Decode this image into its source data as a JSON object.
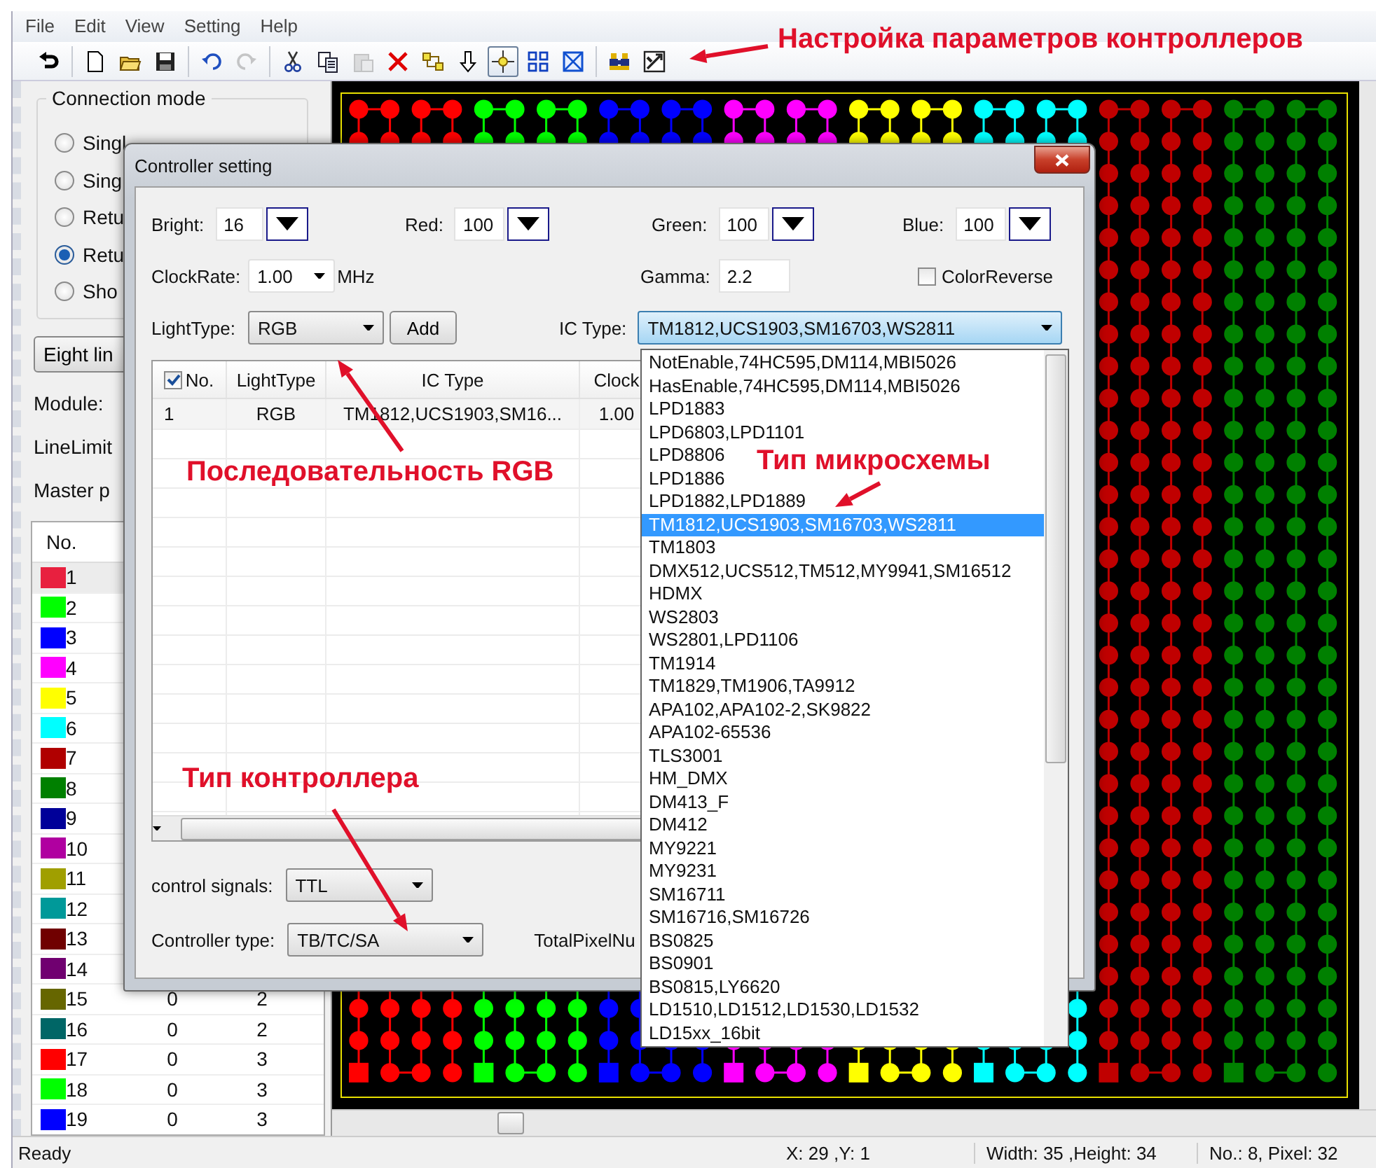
{
  "menu": [
    "File",
    "Edit",
    "View",
    "Setting",
    "Help"
  ],
  "toolbar": [
    [
      {
        "kind": "exit",
        "selected": false,
        "disabled": false
      }
    ],
    [
      {
        "kind": "new",
        "selected": false,
        "disabled": false
      },
      {
        "kind": "open",
        "selected": false,
        "disabled": false
      },
      {
        "kind": "save",
        "selected": false,
        "disabled": false
      }
    ],
    [
      {
        "kind": "undo",
        "selected": false,
        "disabled": false
      },
      {
        "kind": "redo",
        "selected": false,
        "disabled": true
      }
    ],
    [
      {
        "kind": "cut",
        "selected": false,
        "disabled": false
      },
      {
        "kind": "copy",
        "selected": false,
        "disabled": false
      },
      {
        "kind": "paste",
        "selected": false,
        "disabled": true
      },
      {
        "kind": "delete",
        "selected": false,
        "disabled": false
      },
      {
        "kind": "link",
        "selected": false,
        "disabled": false
      },
      {
        "kind": "down",
        "selected": false,
        "disabled": false
      },
      {
        "kind": "crosshair",
        "selected": true,
        "disabled": false
      },
      {
        "kind": "grid",
        "selected": false,
        "disabled": false
      },
      {
        "kind": "frame",
        "selected": false,
        "disabled": false
      }
    ],
    [
      {
        "kind": "find",
        "selected": false,
        "disabled": false
      },
      {
        "kind": "setup",
        "selected": false,
        "disabled": false
      }
    ]
  ],
  "connection_mode": {
    "title": "Connection mode",
    "options": [
      {
        "label": "Singl",
        "selected": false
      },
      {
        "label": "Sing",
        "selected": false
      },
      {
        "label": "Retu",
        "selected": false
      },
      {
        "label": "Retu",
        "selected": true
      },
      {
        "label": "Sho",
        "selected": false
      }
    ]
  },
  "mode_button": "Eight lin",
  "left_labels": [
    "Module:",
    "LineLimit",
    "Master p"
  ],
  "port_table": {
    "header": "No.",
    "rows": [
      {
        "no": "1",
        "color": "#e8203f",
        "selected": true
      },
      {
        "no": "2",
        "color": "#00ff00",
        "selected": false
      },
      {
        "no": "3",
        "color": "#0000ff",
        "selected": false
      },
      {
        "no": "4",
        "color": "#ff00ff",
        "selected": false
      },
      {
        "no": "5",
        "color": "#ffff00",
        "selected": false
      },
      {
        "no": "6",
        "color": "#00ffff",
        "selected": false
      },
      {
        "no": "7",
        "color": "#b00000",
        "selected": false
      },
      {
        "no": "8",
        "color": "#008000",
        "selected": false
      },
      {
        "no": "9",
        "color": "#000099",
        "selected": false
      },
      {
        "no": "10",
        "color": "#b000a0",
        "selected": false
      },
      {
        "no": "11",
        "color": "#a09f00",
        "selected": false
      },
      {
        "no": "12",
        "color": "#009999",
        "selected": false
      },
      {
        "no": "13",
        "color": "#700000",
        "selected": false
      },
      {
        "no": "14",
        "color": "#700070",
        "selected": false
      },
      {
        "no": "15",
        "color": "#666600",
        "selected": false,
        "column_2": "0",
        "column_3": "2"
      },
      {
        "no": "16",
        "color": "#006666",
        "selected": false,
        "column_2": "0",
        "column_3": "2"
      },
      {
        "no": "17",
        "color": "#ff0000",
        "selected": false,
        "column_2": "0",
        "column_3": "3"
      },
      {
        "no": "18",
        "color": "#00ff00",
        "selected": false,
        "column_2": "0",
        "column_3": "3"
      },
      {
        "no": "19",
        "color": "#0000ff",
        "selected": false,
        "column_2": "0",
        "column_3": "3"
      }
    ]
  },
  "dialog": {
    "title": "Controller setting",
    "spinners": [
      {
        "label": "Bright:",
        "value": "16"
      },
      {
        "label": "Red:",
        "value": "100"
      },
      {
        "label": "Green:",
        "value": "100"
      },
      {
        "label": "Blue:",
        "value": "100"
      }
    ],
    "clock_rate": {
      "label": "ClockRate:",
      "value": "1.00",
      "unit": "MHz"
    },
    "gamma": {
      "label": "Gamma:",
      "value": "2.2"
    },
    "color_reverse": {
      "label": "ColorReverse",
      "checked": false
    },
    "light_type": {
      "label": "LightType:",
      "value": "RGB"
    },
    "add_button": "Add",
    "ic_type": {
      "label": "IC Type:",
      "value": "TM1812,UCS1903,SM16703,WS2811",
      "expanded": true,
      "options": [
        {
          "label": "NotEnable,74HC595,DM114,MBI5026",
          "selected": false
        },
        {
          "label": "HasEnable,74HC595,DM114,MBI5026",
          "selected": false
        },
        {
          "label": "LPD1883",
          "selected": false
        },
        {
          "label": "LPD6803,LPD1101",
          "selected": false
        },
        {
          "label": "LPD8806",
          "selected": false
        },
        {
          "label": "LPD1886",
          "selected": false
        },
        {
          "label": "LPD1882,LPD1889",
          "selected": false
        },
        {
          "label": "TM1812,UCS1903,SM16703,WS2811",
          "selected": true
        },
        {
          "label": "TM1803",
          "selected": false
        },
        {
          "label": "DMX512,UCS512,TM512,MY9941,SM16512",
          "selected": false
        },
        {
          "label": "HDMX",
          "selected": false
        },
        {
          "label": "WS2803",
          "selected": false
        },
        {
          "label": "WS2801,LPD1106",
          "selected": false
        },
        {
          "label": "TM1914",
          "selected": false
        },
        {
          "label": "TM1829,TM1906,TA9912",
          "selected": false
        },
        {
          "label": "APA102,APA102-2,SK9822",
          "selected": false
        },
        {
          "label": "APA102-65536",
          "selected": false
        },
        {
          "label": "TLS3001",
          "selected": false
        },
        {
          "label": "HM_DMX",
          "selected": false
        },
        {
          "label": "DM413_F",
          "selected": false
        },
        {
          "label": "DM412",
          "selected": false
        },
        {
          "label": "MY9221",
          "selected": false
        },
        {
          "label": "MY9231",
          "selected": false
        },
        {
          "label": "SM16711",
          "selected": false
        },
        {
          "label": "SM16716,SM16726",
          "selected": false
        },
        {
          "label": "BS0825",
          "selected": false
        },
        {
          "label": "BS0901",
          "selected": false
        },
        {
          "label": "BS0815,LY6620",
          "selected": false
        },
        {
          "label": "LD1510,LD1512,LD1530,LD1532",
          "selected": false
        },
        {
          "label": "LD15xx_16bit",
          "selected": false
        }
      ]
    },
    "table": {
      "select_all_checked": true,
      "columns": [
        "No.",
        "LightType",
        "IC Type",
        "Clock"
      ],
      "rows": [
        {
          "cells": [
            "1",
            "RGB",
            "TM1812,UCS1903,SM16...",
            "1.00"
          ]
        }
      ]
    },
    "control_signals": {
      "label": "control signals:",
      "value": "TTL"
    },
    "controller_type": {
      "label": "Controller type:",
      "value": "TB/TC/SA"
    },
    "total_pixel_label": "TotalPixelNu"
  },
  "annotations": [
    {
      "text": "Настройка параметров контроллеров"
    },
    {
      "text": "Последовательность RGB"
    },
    {
      "text": "Тип микросхемы"
    },
    {
      "text": "Тип контроллера"
    }
  ],
  "status_bar": [
    "Ready",
    "X: 29 ,Y: 1",
    "Width: 35 ,Height: 34",
    "No.: 8, Pixel: 32"
  ]
}
